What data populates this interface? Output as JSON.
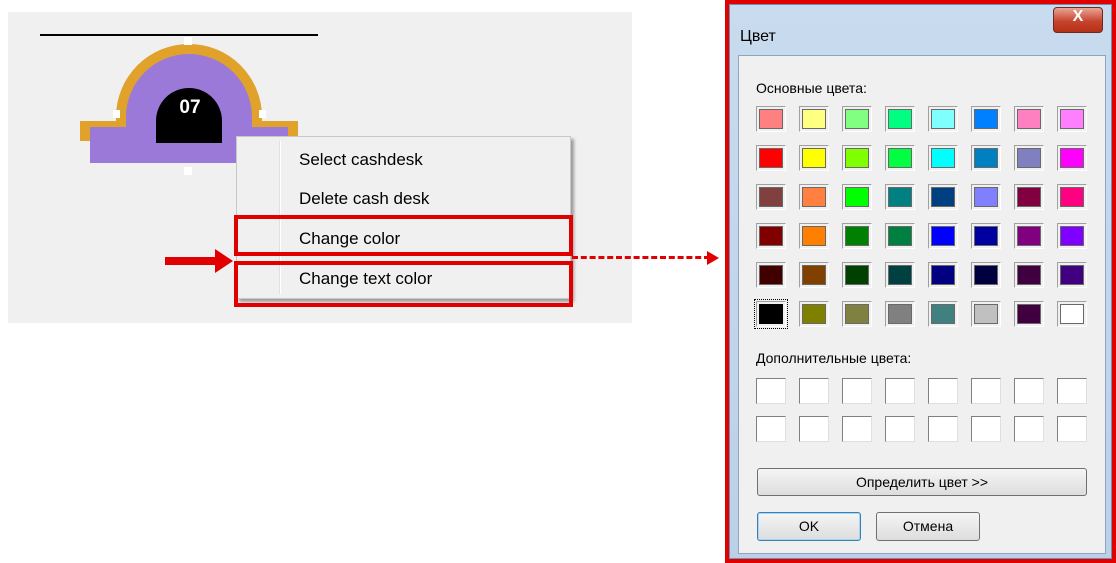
{
  "desk": {
    "number": "07",
    "fill_color": "#9b79d8",
    "border_color": "#e0a22a"
  },
  "context_menu": {
    "items": [
      {
        "label": "Select cashdesk"
      },
      {
        "label": "Delete cash desk"
      },
      {
        "label": "Change color",
        "highlighted": true
      },
      {
        "label": "Change text color",
        "highlighted": true
      }
    ]
  },
  "dialog": {
    "title": "Цвет",
    "close_label": "X",
    "basic_colors_label": "Основные цвета:",
    "basic_colors": [
      [
        "#ff8080",
        "#ffff80",
        "#80ff80",
        "#00ff80",
        "#80ffff",
        "#0080ff",
        "#ff80c0",
        "#ff80ff"
      ],
      [
        "#ff0000",
        "#ffff00",
        "#80ff00",
        "#00ff40",
        "#00ffff",
        "#0080c0",
        "#8080c0",
        "#ff00ff"
      ],
      [
        "#804040",
        "#ff8040",
        "#00ff00",
        "#008080",
        "#004080",
        "#8080ff",
        "#800040",
        "#ff0080"
      ],
      [
        "#800000",
        "#ff8000",
        "#008000",
        "#008040",
        "#0000ff",
        "#0000a0",
        "#800080",
        "#8000ff"
      ],
      [
        "#400000",
        "#804000",
        "#004000",
        "#004040",
        "#000080",
        "#000040",
        "#400040",
        "#400080"
      ],
      [
        "#000000",
        "#808000",
        "#808040",
        "#808080",
        "#408080",
        "#c0c0c0",
        "#400040",
        "#ffffff"
      ]
    ],
    "selected_color": "#000000",
    "custom_colors_label": "Дополнительные цвета:",
    "custom_colors": [
      [
        "#ffffff",
        "#ffffff",
        "#ffffff",
        "#ffffff",
        "#ffffff",
        "#ffffff",
        "#ffffff",
        "#ffffff"
      ],
      [
        "#ffffff",
        "#ffffff",
        "#ffffff",
        "#ffffff",
        "#ffffff",
        "#ffffff",
        "#ffffff",
        "#ffffff"
      ]
    ],
    "define_button": "Определить цвет >>",
    "ok_button": "OK",
    "cancel_button": "Отмена"
  },
  "colors": {
    "annotation_red": "#e00000",
    "canvas_bg": "#f0f0f0"
  }
}
